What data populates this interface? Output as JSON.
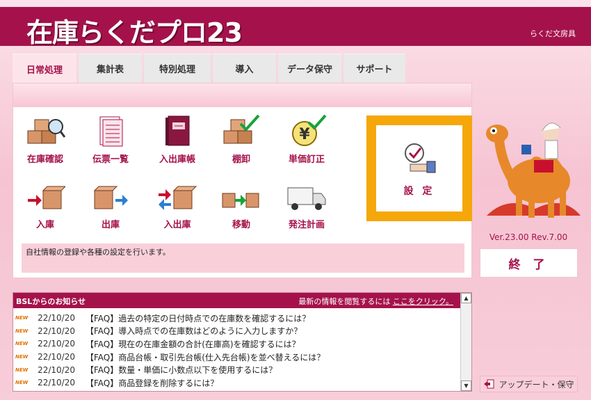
{
  "app": {
    "brand": "在庫らくだプロ23",
    "maker": "らくだ文房具",
    "version": "Ver.23.00 Rev.7.00"
  },
  "tabs": [
    {
      "label": "日常処理"
    },
    {
      "label": "集計表"
    },
    {
      "label": "特別処理"
    },
    {
      "label": "導入"
    },
    {
      "label": "データ保守"
    },
    {
      "label": "サポート"
    }
  ],
  "functions": {
    "stock_check": "在庫確認",
    "slip_list": "伝票一覧",
    "inout_ledger": "入出庫帳",
    "inventory": "棚卸",
    "price_fix": "単価訂正",
    "receiving": "入庫",
    "shipping": "出庫",
    "inout": "入出庫",
    "transfer": "移動",
    "order_plan": "発注計画"
  },
  "settings_label": "設 定",
  "status_text": "自社情報の登録や各種の設定を行います。",
  "exit_label": "終 了",
  "news": {
    "title": "BSLからのお知らせ",
    "hint": "最新の情報を閲覧するには",
    "link": "ここをクリック。",
    "new_badge": "NEW",
    "items": [
      {
        "date": "22/10/20",
        "text": "【FAQ】過去の特定の日付時点での在庫数を確認するには？"
      },
      {
        "date": "22/10/20",
        "text": "【FAQ】導入時点での在庫数はどのように入力しますか？"
      },
      {
        "date": "22/10/20",
        "text": "【FAQ】現在の在庫金額の合計(在庫高)を確認するには？"
      },
      {
        "date": "22/10/20",
        "text": "【FAQ】商品台帳・取引先台帳(仕入先台帳)を並べ替えるには？"
      },
      {
        "date": "22/10/20",
        "text": "【FAQ】数量・単価に小数点以下を使用するには？"
      },
      {
        "date": "22/10/20",
        "text": "【FAQ】商品登録を削除するには？"
      }
    ]
  },
  "update_label": "アップデート・保守",
  "colors": {
    "brand": "#a5124b",
    "highlight": "#f5a70a",
    "box": "#d9956a"
  }
}
